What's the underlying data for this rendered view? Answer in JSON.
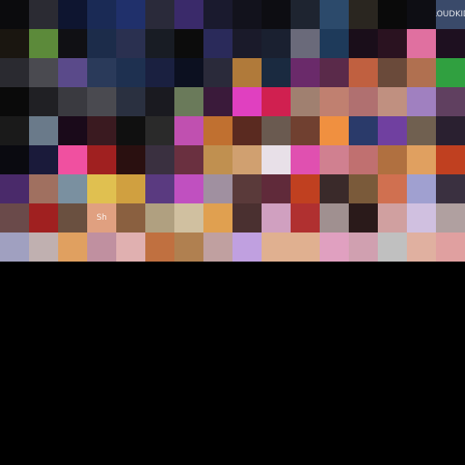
{
  "gallery": {
    "rows": [
      [
        "#0b0b0d",
        "#2b2b33",
        "#0e1530",
        "#1a2a55",
        "#20306b",
        "#2a2a3a",
        "#3a2a6a",
        "#1a1a2e",
        "#12121c",
        "#0d0d12",
        "#1e2430",
        "#2c4a6b",
        "#2a2620",
        "#0a0a0a",
        "#0e0e14",
        "#3a4a6a"
      ],
      [
        "#1a1610",
        "#5c8a3a",
        "#101014",
        "#1c2c4a",
        "#2a3050",
        "#181c24",
        "#0c0c0c",
        "#2a2a5a",
        "#1a1a2a",
        "#1a2030",
        "#6a6a7a",
        "#1e3a5a",
        "#1a0e1a",
        "#2a1220",
        "#e070a0",
        "#1e1020"
      ],
      [
        "#2a2a30",
        "#4a4a50",
        "#5a4a8a",
        "#2a3a5a",
        "#1e3050",
        "#1a2040",
        "#0c1020",
        "#2a2a3a",
        "#b07a3a",
        "#1a2a40",
        "#6a2a6a",
        "#5a2a4a",
        "#c06040",
        "#6a4a3a",
        "#b07050",
        "#30a040"
      ],
      [
        "#0a0a0a",
        "#202024",
        "#3a3a40",
        "#4a4a50",
        "#2a3040",
        "#1a1a20",
        "#6a7a5a",
        "#3a1a3a",
        "#e040c0",
        "#d02050",
        "#a08070",
        "#c08070",
        "#b07070",
        "#c09080",
        "#a080c0",
        "#604060"
      ],
      [
        "#1a1a1a",
        "#6a7a8a",
        "#1a0a1a",
        "#3a1a20",
        "#101010",
        "#2a2a2a",
        "#c050b0",
        "#c07030",
        "#5a2a20",
        "#6a5a50",
        "#704030",
        "#f09040",
        "#2a3a6a",
        "#7040a0",
        "#706050",
        "#2a2030"
      ],
      [
        "#0a0a10",
        "#1a1a3a",
        "#f050a0",
        "#a02020",
        "#2a1010",
        "#3a3040",
        "#6a3040",
        "#c09050",
        "#d0a070",
        "#e8e0e8",
        "#e050b0",
        "#d08090",
        "#c07070",
        "#b07040",
        "#e0a060",
        "#c04020"
      ],
      [
        "#4a2a6a",
        "#a07060",
        "#7a90a0",
        "#e0c050",
        "#d0a040",
        "#5a3a80",
        "#c050c0",
        "#a090a0",
        "#5a3a3a",
        "#602a3a",
        "#c04020",
        "#3a2a2a",
        "#7a5a3a",
        "#d07050",
        "#a0a0d0",
        "#3a3040"
      ],
      [
        "#6a4a4a",
        "#a02020",
        "#6a5040",
        "#e0a080",
        "#8a6040",
        "#b0a080",
        "#d0c0a0",
        "#e0a050",
        "#4a3030",
        "#d0a0c0",
        "#b03030",
        "#a09090",
        "#2a1a1a",
        "#d0a0a0",
        "#d0c0e0",
        "#b0a0a0"
      ],
      [
        "#a0a0c0",
        "#c0b0b0",
        "#e0a060",
        "#c090a0",
        "#e0b0b0",
        "#c07040",
        "#b08050",
        "#c0a0a0",
        "#c0a0e0",
        "#e0b090",
        "#e0b090",
        "#e0a0c0",
        "#d0a0b0",
        "#c0c0c0",
        "#e0b0a0",
        "#e0a0a0"
      ]
    ],
    "tile_labels": [
      [
        "",
        "",
        "",
        "",
        "",
        "",
        "",
        "",
        "",
        "",
        "",
        "",
        "",
        "",
        "",
        "CLOUDKIDS"
      ],
      [
        "",
        "",
        "",
        "",
        "",
        "",
        "",
        "",
        "",
        "",
        "",
        "",
        "",
        "",
        "",
        ""
      ],
      [
        "",
        "",
        "",
        "",
        "",
        "",
        "",
        "",
        "",
        "",
        "",
        "",
        "",
        "",
        "",
        ""
      ],
      [
        "",
        "",
        "",
        "",
        "",
        "",
        "",
        "",
        "",
        "",
        "",
        "",
        "",
        "",
        "",
        ""
      ],
      [
        "",
        "",
        "",
        "",
        "",
        "",
        "",
        "",
        "",
        "",
        "",
        "",
        "",
        "",
        "",
        ""
      ],
      [
        "",
        "",
        "",
        "",
        "",
        "",
        "",
        "",
        "",
        "",
        "",
        "",
        "",
        "",
        "",
        ""
      ],
      [
        "",
        "",
        "",
        "",
        "",
        "",
        "",
        "",
        "",
        "",
        "",
        "",
        "",
        "",
        "",
        ""
      ],
      [
        "",
        "",
        "",
        "Sh",
        "",
        "",
        "",
        "",
        "",
        "",
        "",
        "",
        "",
        "",
        "",
        ""
      ],
      [
        "",
        "",
        "",
        "",
        "",
        "",
        "",
        "",
        "",
        "",
        "",
        "",
        "",
        "",
        "",
        ""
      ]
    ]
  }
}
